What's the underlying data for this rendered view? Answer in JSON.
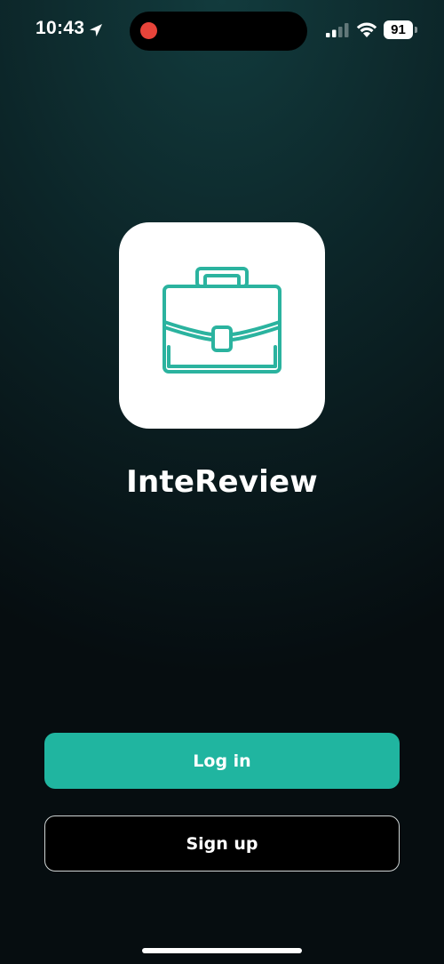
{
  "status_bar": {
    "time": "10:43",
    "battery_level": "91",
    "location_icon": "location-arrow-icon",
    "signal_icon": "cellular-signal-icon",
    "wifi_icon": "wifi-icon",
    "recording_indicator_color": "#e8443a"
  },
  "app": {
    "icon": "briefcase-icon",
    "name": "InteReview",
    "accent_color": "#20b5a0"
  },
  "actions": {
    "login_label": "Log in",
    "signup_label": "Sign up"
  }
}
